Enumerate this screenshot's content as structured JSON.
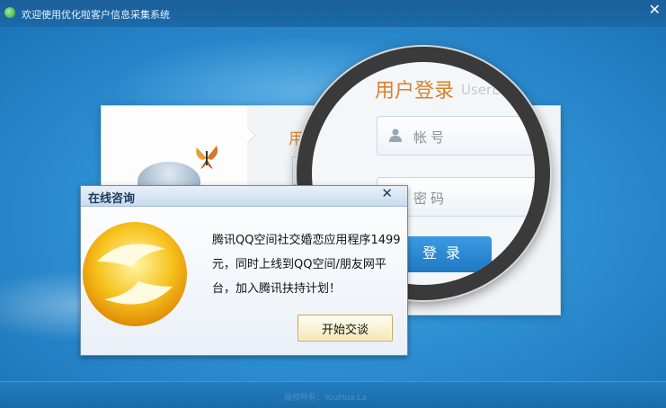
{
  "window": {
    "title": "欢迎使用优化啦客户信息采集系统",
    "close_glyph": "✕"
  },
  "login": {
    "peek_title": "用",
    "title": "用户登录",
    "subtitle": "UserL",
    "account_placeholder": "帐号",
    "password_placeholder": "密码",
    "login_button": "登录"
  },
  "popup": {
    "title": "在线咨询",
    "close_glyph": "✕",
    "message": "腾讯QQ空间社交婚恋应用程序1499元，同时上线到QQ空间/朋友网平台，加入腾讯扶持计划！",
    "chat_button": "开始交谈"
  },
  "footer": {
    "copyright": "版权所有：YouHua.La"
  },
  "colors": {
    "background": "#2f93d6",
    "title_bar": "#1b5f99",
    "login_title": "#d9822b",
    "login_button": "#1f78c3",
    "popup_border": "#6a8db3"
  },
  "icons": [
    "app-icon",
    "user-icon",
    "lock-icon",
    "close-icon",
    "qq-space-logo",
    "butterfly-icon"
  ]
}
